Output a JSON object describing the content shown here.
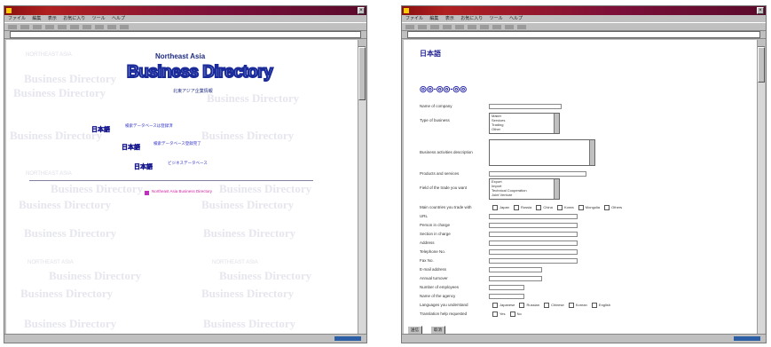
{
  "left_window": {
    "menu": [
      "ファイル",
      "編集",
      "表示",
      "お気に入り",
      "ツール",
      "ヘルプ"
    ],
    "page": {
      "heading_top": "Northeast Asia",
      "heading_main": "Business Directory",
      "subheading": "北東アジア企業情報",
      "watermark_text": "Business Directory",
      "watermark_small": "NORTHEAST ASIA",
      "links": [
        {
          "button": "日本語",
          "label": "検索データベースは登録済"
        },
        {
          "button": "日本語",
          "label": "検索データベース登録完了"
        },
        {
          "button": "日本語",
          "label": "ビジネスデータベース"
        }
      ],
      "footer_link": "Northeast Asia Business Directory"
    }
  },
  "right_window": {
    "menu": [
      "ファイル",
      "編集",
      "表示",
      "お気に入り",
      "ツール",
      "ヘルプ"
    ],
    "page": {
      "heading": "日本語",
      "tabs": "◎◎-◎◎-◎◎",
      "form_rows": [
        "Name of company",
        "Type of business",
        "Business activities description",
        "Products and services",
        "Field of the trade you want",
        "Main countries you trade with",
        "URL",
        "Person in charge",
        "Section in charge",
        "Address",
        "Telephone No.",
        "Fax No.",
        "E-mail address",
        "Annual turnover",
        "Number of employees",
        "Name of the agency",
        "Languages you understand",
        "Translation help requested"
      ],
      "type_of_business_options": [
        "Maker",
        "Services",
        "Trading",
        "Other"
      ],
      "field_options": [
        "Export",
        "Import",
        "Technical Cooperation",
        "Joint Venture",
        "Other"
      ],
      "country_options": [
        "Japan",
        "Russia",
        "China",
        "Korea",
        "Mongolia",
        "Others"
      ],
      "language_options": [
        "Japanese",
        "Russian",
        "Chinese",
        "Korean",
        "English"
      ],
      "translation_options": [
        "Yes",
        "No"
      ],
      "submit_label": "送信",
      "reset_label": "取消"
    }
  }
}
